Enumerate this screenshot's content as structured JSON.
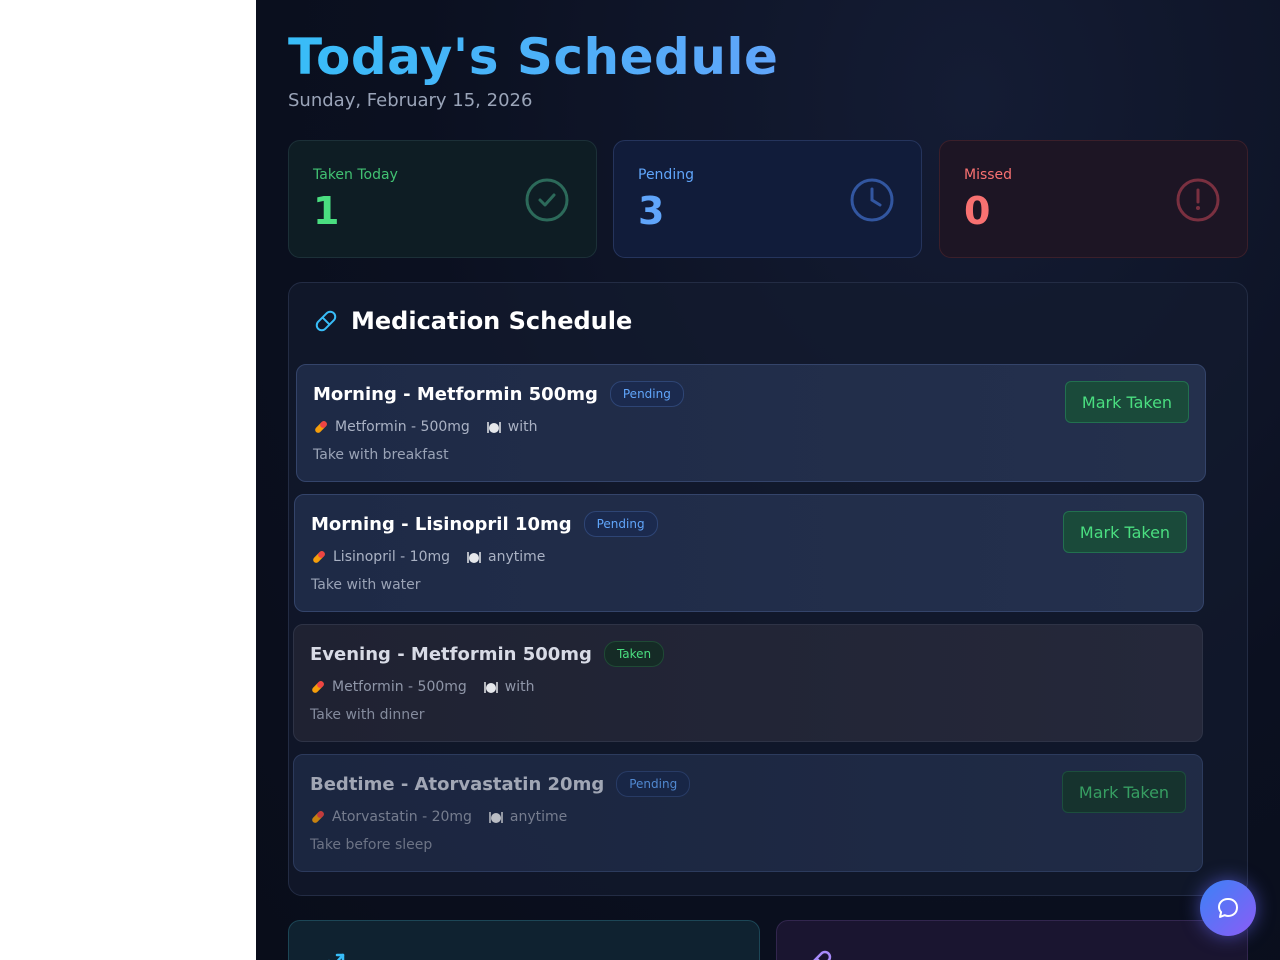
{
  "header": {
    "title": "Today's Schedule",
    "date": "Sunday, February 15, 2026"
  },
  "stats": {
    "taken": {
      "label": "Taken Today",
      "value": "1",
      "icon": "check-circle-icon",
      "color": "#4ade80"
    },
    "pending": {
      "label": "Pending",
      "value": "3",
      "icon": "clock-icon",
      "color": "#60a5fa"
    },
    "missed": {
      "label": "Missed",
      "value": "0",
      "icon": "alert-circle-icon",
      "color": "#f87171"
    }
  },
  "schedule": {
    "title": "Medication Schedule",
    "icon": "pill-icon",
    "items": [
      {
        "title": "Morning - Metformin 500mg",
        "status": "Pending",
        "medication": "Metformin - 500mg",
        "food": "with",
        "note": "Take with breakfast",
        "action": "Mark Taken"
      },
      {
        "title": "Morning - Lisinopril 10mg",
        "status": "Pending",
        "medication": "Lisinopril - 10mg",
        "food": "anytime",
        "note": "Take with water",
        "action": "Mark Taken"
      },
      {
        "title": "Evening - Metformin 500mg",
        "status": "Taken",
        "medication": "Metformin - 500mg",
        "food": "with",
        "note": "Take with dinner"
      },
      {
        "title": "Bedtime - Atorvastatin 20mg",
        "status": "Pending",
        "medication": "Atorvastatin - 20mg",
        "food": "anytime",
        "note": "Take before sleep",
        "action": "Mark Taken"
      }
    ]
  },
  "chat": {
    "icon": "chat-bubble-icon"
  },
  "colors": {
    "accent": "#38bdf8",
    "success": "#4ade80",
    "danger": "#f87171",
    "pending": "#60a5fa"
  }
}
